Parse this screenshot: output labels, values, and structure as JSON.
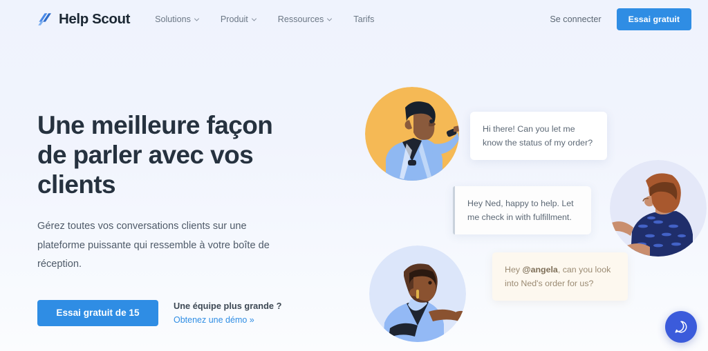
{
  "brand": {
    "name": "Help Scout",
    "logo_icon": "helpscout-slashes-logo",
    "logo_color": "#3E7FE0"
  },
  "header": {
    "nav": [
      {
        "label": "Solutions",
        "has_caret": true,
        "caret_icon": "chevron-down-icon"
      },
      {
        "label": "Produit",
        "has_caret": true,
        "caret_icon": "chevron-down-icon"
      },
      {
        "label": "Ressources",
        "has_caret": true,
        "caret_icon": "chevron-down-icon"
      },
      {
        "label": "Tarifs",
        "has_caret": false,
        "caret_icon": ""
      }
    ],
    "login_label": "Se connecter",
    "trial_label": "Essai gratuit"
  },
  "hero": {
    "headline": "Une meilleure façon de parler avec vos clients",
    "subhead": "Gérez toutes vos conversations clients sur une plateforme puissante qui ressemble à votre boîte de réception.",
    "cta_label": "Essai gratuit de 15",
    "demo_title": "Une équipe plus grande ?",
    "demo_link": "Obtenez une démo »"
  },
  "illustration": {
    "avatars": [
      {
        "name": "avatar-top-agent",
        "circle_color": "#F5B955"
      },
      {
        "name": "avatar-right-customer",
        "circle_color": "#E4E8F8"
      },
      {
        "name": "avatar-bottom-agent",
        "circle_color": "#DCE6FA"
      }
    ],
    "bubbles": [
      {
        "name": "chat-bubble-customer",
        "text": "Hi there! Can you let me know the status of my order?",
        "background": "#FFFFFF"
      },
      {
        "name": "chat-bubble-agent",
        "text": "Hey Ned, happy to help. Let me check in with fulfillment.",
        "background": "#FDFDFD"
      },
      {
        "name": "chat-bubble-internal-note",
        "text_before": "Hey ",
        "mention": "@angela",
        "text_after": ", can you look into Ned's order for us?",
        "background": "#FDF8EF"
      }
    ]
  },
  "beacon": {
    "icon": "chat-beacon-icon",
    "color": "#3B5BDB"
  },
  "theme": {
    "accent_blue": "#2F8DE4",
    "page_background": "#F1F4FD",
    "heading_color": "#26323F"
  }
}
